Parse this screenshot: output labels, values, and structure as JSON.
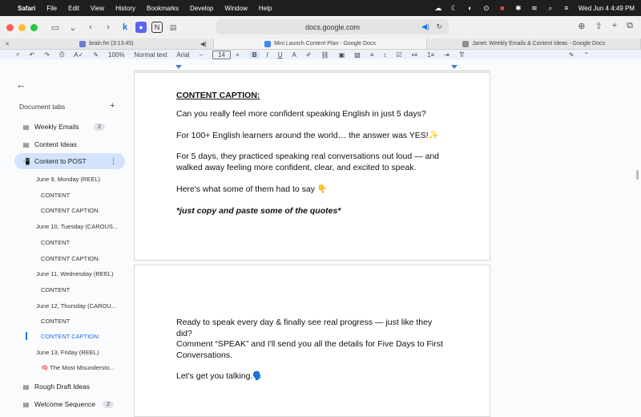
{
  "menubar": {
    "app": "Safari",
    "items": [
      "File",
      "Edit",
      "View",
      "History",
      "Bookmarks",
      "Develop",
      "Window",
      "Help"
    ],
    "datetime": "Wed Jun 4  4:49 PM"
  },
  "browser": {
    "url": "docs.google.com",
    "tabs": [
      {
        "label": "brain.fm (3:13:45)"
      },
      {
        "label": "Mini Launch Content Plan - Google Docs"
      },
      {
        "label": "Janet: Weekly Emails & Content Ideas - Google Docs"
      }
    ]
  },
  "docbar": {
    "zoom": "100%",
    "style": "Normal text",
    "font": "Arial",
    "size": "14",
    "bold": "B"
  },
  "sidebar": {
    "heading": "Document tabs",
    "tabs": [
      {
        "label": "Weekly Emails",
        "badge": "2"
      },
      {
        "label": "Content Ideas"
      },
      {
        "label": "Content to POST"
      },
      {
        "label": "Rough Draft Ideas"
      },
      {
        "label": "Welcome Sequence",
        "badge": "2"
      }
    ],
    "subitems": [
      "June 9, Monday (REEL)",
      "CONTENT",
      "CONTENT CAPTION:",
      "June 10, Tuesday (CAROUS...",
      "CONTENT",
      "CONTENT CAPTION:",
      "June 11, Wednesday (REEL)",
      "CONTENT",
      "June 12, Thursday (CAROU...",
      "CONTENT",
      "CONTENT CAPTION:",
      "June 13, Friday (REEL)",
      "The Most Misundersto..."
    ]
  },
  "doc": {
    "heading": "CONTENT CAPTION:",
    "p1": "Can you really feel more confident speaking English in just 5 days?",
    "p2": "For 100+ English learners around the world… the answer was YES!✨",
    "p3": "For 5 days, they practiced speaking real conversations out loud — and walked away feeling more confident, clear, and excited to speak.",
    "p4": "Here's what some of them had to say 👇",
    "p5": "*just copy and paste some of the quotes*",
    "p6": "Ready to speak every day & finally see real progress — just like they did?",
    "p7": "Comment “SPEAK” and I'll send you all the details for Five Days to First Conversations.",
    "p8": "Let's get you talking.🗣️"
  }
}
